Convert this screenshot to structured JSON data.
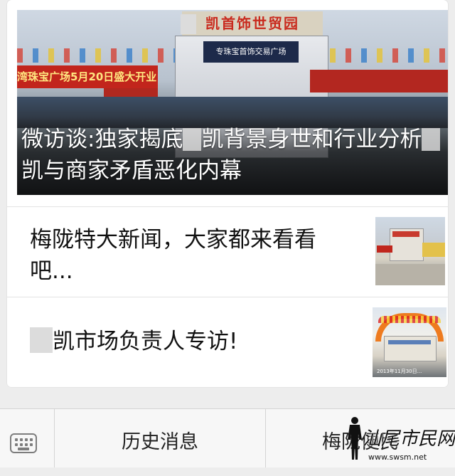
{
  "feed": {
    "hero": {
      "title_part1": "微访谈:独家揭底",
      "title_part2": "凯背景身世和行业分析",
      "title_part3": "凯与商家矛盾恶化内幕",
      "building_sign": "凯首饰世贸园",
      "banner_left": "湾珠宝广场5月20日盛大开业",
      "building_mid_sign": "专珠宝首饰交易广场"
    },
    "items": [
      {
        "title": "梅陇特大新闻，大家都来看看吧..."
      },
      {
        "title": "凯市场负责人专访!",
        "thumb_stamp": "2013年11月30日..."
      }
    ]
  },
  "bottom_bar": {
    "history_label": "历史消息",
    "menu2_label": "梅陇便民"
  },
  "watermark": {
    "text": "汕尾市民网",
    "url": "www.swsm.net"
  }
}
